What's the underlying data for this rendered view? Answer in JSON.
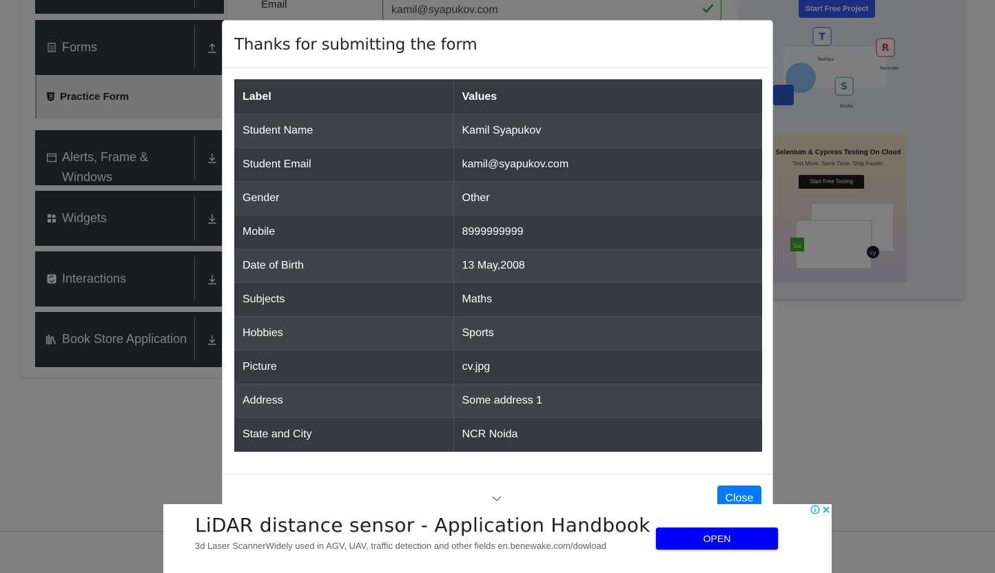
{
  "background": {
    "email_label": "Email",
    "email_value": "kamil@syapukov.com",
    "sidebar": {
      "groups": [
        {
          "label": "Forms",
          "icon": "document-icon",
          "arrow": "upload-arrow-icon"
        },
        {
          "label": "Alerts, Frame & Windows",
          "icon": "window-icon",
          "arrow": "download-arrow-icon"
        },
        {
          "label": "Widgets",
          "icon": "widgets-icon",
          "arrow": "download-arrow-icon"
        },
        {
          "label": "Interactions",
          "icon": "interactions-icon",
          "arrow": "download-arrow-icon"
        },
        {
          "label": "Book Store Application",
          "icon": "books-icon",
          "arrow": "download-arrow-icon"
        }
      ],
      "active_item": "Practice Form"
    },
    "side_ads": {
      "top_button": "Start Free Project",
      "top_labels": [
        "TestOps",
        "Recorder",
        "Studio"
      ],
      "bottom_title": "Selenium & Cypress Testing On Cloud",
      "bottom_subtitle": "Test More. Save Time. Ship Faster.",
      "bottom_button": "Start Free Testing"
    }
  },
  "modal": {
    "title": "Thanks for submitting the form",
    "table": {
      "headers": [
        "Label",
        "Values"
      ],
      "rows": [
        [
          "Student Name",
          "Kamil Syapukov"
        ],
        [
          "Student Email",
          "kamil@syapukov.com"
        ],
        [
          "Gender",
          "Other"
        ],
        [
          "Mobile",
          "8999999999"
        ],
        [
          "Date of Birth",
          "13 May,2008"
        ],
        [
          "Subjects",
          "Maths"
        ],
        [
          "Hobbies",
          "Sports"
        ],
        [
          "Picture",
          "cv.jpg"
        ],
        [
          "Address",
          "Some address 1"
        ],
        [
          "State and City",
          "NCR Noida"
        ]
      ]
    },
    "close_label": "Close"
  },
  "bottom_ad": {
    "title": "LiDAR distance sensor - Application Handbook",
    "description": "3d Laser ScannerWidely used in AGV, UAV, traffic detection and other fields en.benewake.com/dowload",
    "button": "OPEN"
  },
  "colors": {
    "table_bg": "#343a40",
    "primary": "#007bff",
    "ad_button": "#0000ff",
    "valid_green": "#28a745"
  }
}
